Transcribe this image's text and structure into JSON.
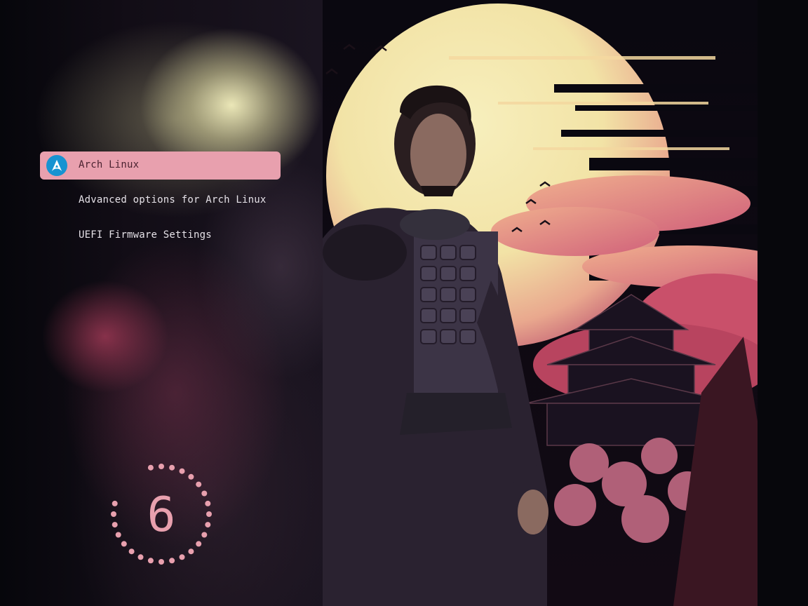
{
  "menu": {
    "items": [
      {
        "label": "Arch Linux",
        "icon": "arch-linux-icon",
        "selected": true
      },
      {
        "label": "Advanced options for Arch Linux",
        "selected": false
      },
      {
        "label": "UEFI Firmware Settings",
        "selected": false
      }
    ]
  },
  "countdown": {
    "value": "6"
  },
  "colors": {
    "accent": "#e8a0ae",
    "selected_text": "#4a2230",
    "menu_text": "#e6e2e8",
    "arch_blue": "#1793d1",
    "background": "#07070c"
  }
}
